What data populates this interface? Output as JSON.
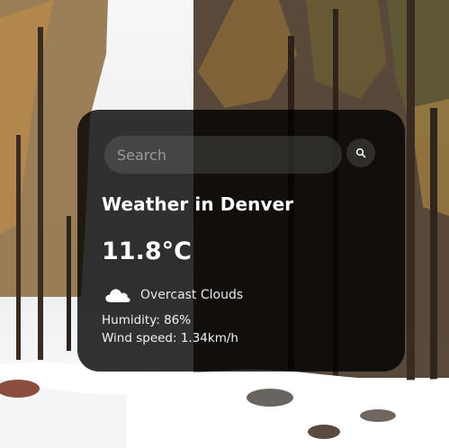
{
  "search": {
    "placeholder": "Search",
    "button_icon": "search-icon"
  },
  "weather": {
    "title": "Weather in Denver",
    "temperature": "11.8°C",
    "condition_icon": "cloud-icon",
    "condition": "Overcast Clouds",
    "humidity": "Humidity: 86%",
    "wind": "Wind speed: 1.34km/h"
  },
  "colors": {
    "card_background": "#000000cc",
    "text": "#ffffff"
  }
}
